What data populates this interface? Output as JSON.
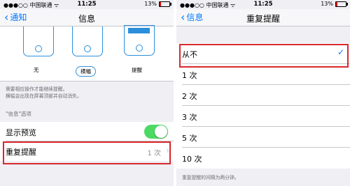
{
  "left": {
    "status": {
      "carrier": "●●●○○ 中国联通 ᯤ",
      "time": "11:25",
      "battery": "13%",
      "battery_level": 0.13
    },
    "nav": {
      "back": "通知",
      "title": "信息"
    },
    "previews": [
      {
        "label": "无",
        "selected": false
      },
      {
        "label": "横幅",
        "selected": true
      },
      {
        "label": "提醒",
        "selected": false
      }
    ],
    "note_lines": [
      "需要相应操作才能继续提醒。",
      "横幅会出现在屏幕顶部并自动消失。"
    ],
    "section_header": "\"信息\"选项",
    "rows": {
      "show_preview": {
        "label": "显示预览",
        "on": true
      },
      "repeat": {
        "label": "重复提醒",
        "value": "1 次"
      }
    }
  },
  "right": {
    "status": {
      "carrier": "●●●○○ 中国联通 ᯤ",
      "time": "11:25",
      "battery": "13%",
      "battery_level": 0.13
    },
    "nav": {
      "back": "信息",
      "title": "重复提醒"
    },
    "options": [
      "从不",
      "1 次",
      "2 次",
      "3 次",
      "5 次",
      "10 次"
    ],
    "selected": "从不",
    "footer": "重复提醒的间隔为两分钟。"
  },
  "colors": {
    "accent": "#007aff",
    "highlight": "#d8282c",
    "toggle_on": "#4cd964"
  }
}
